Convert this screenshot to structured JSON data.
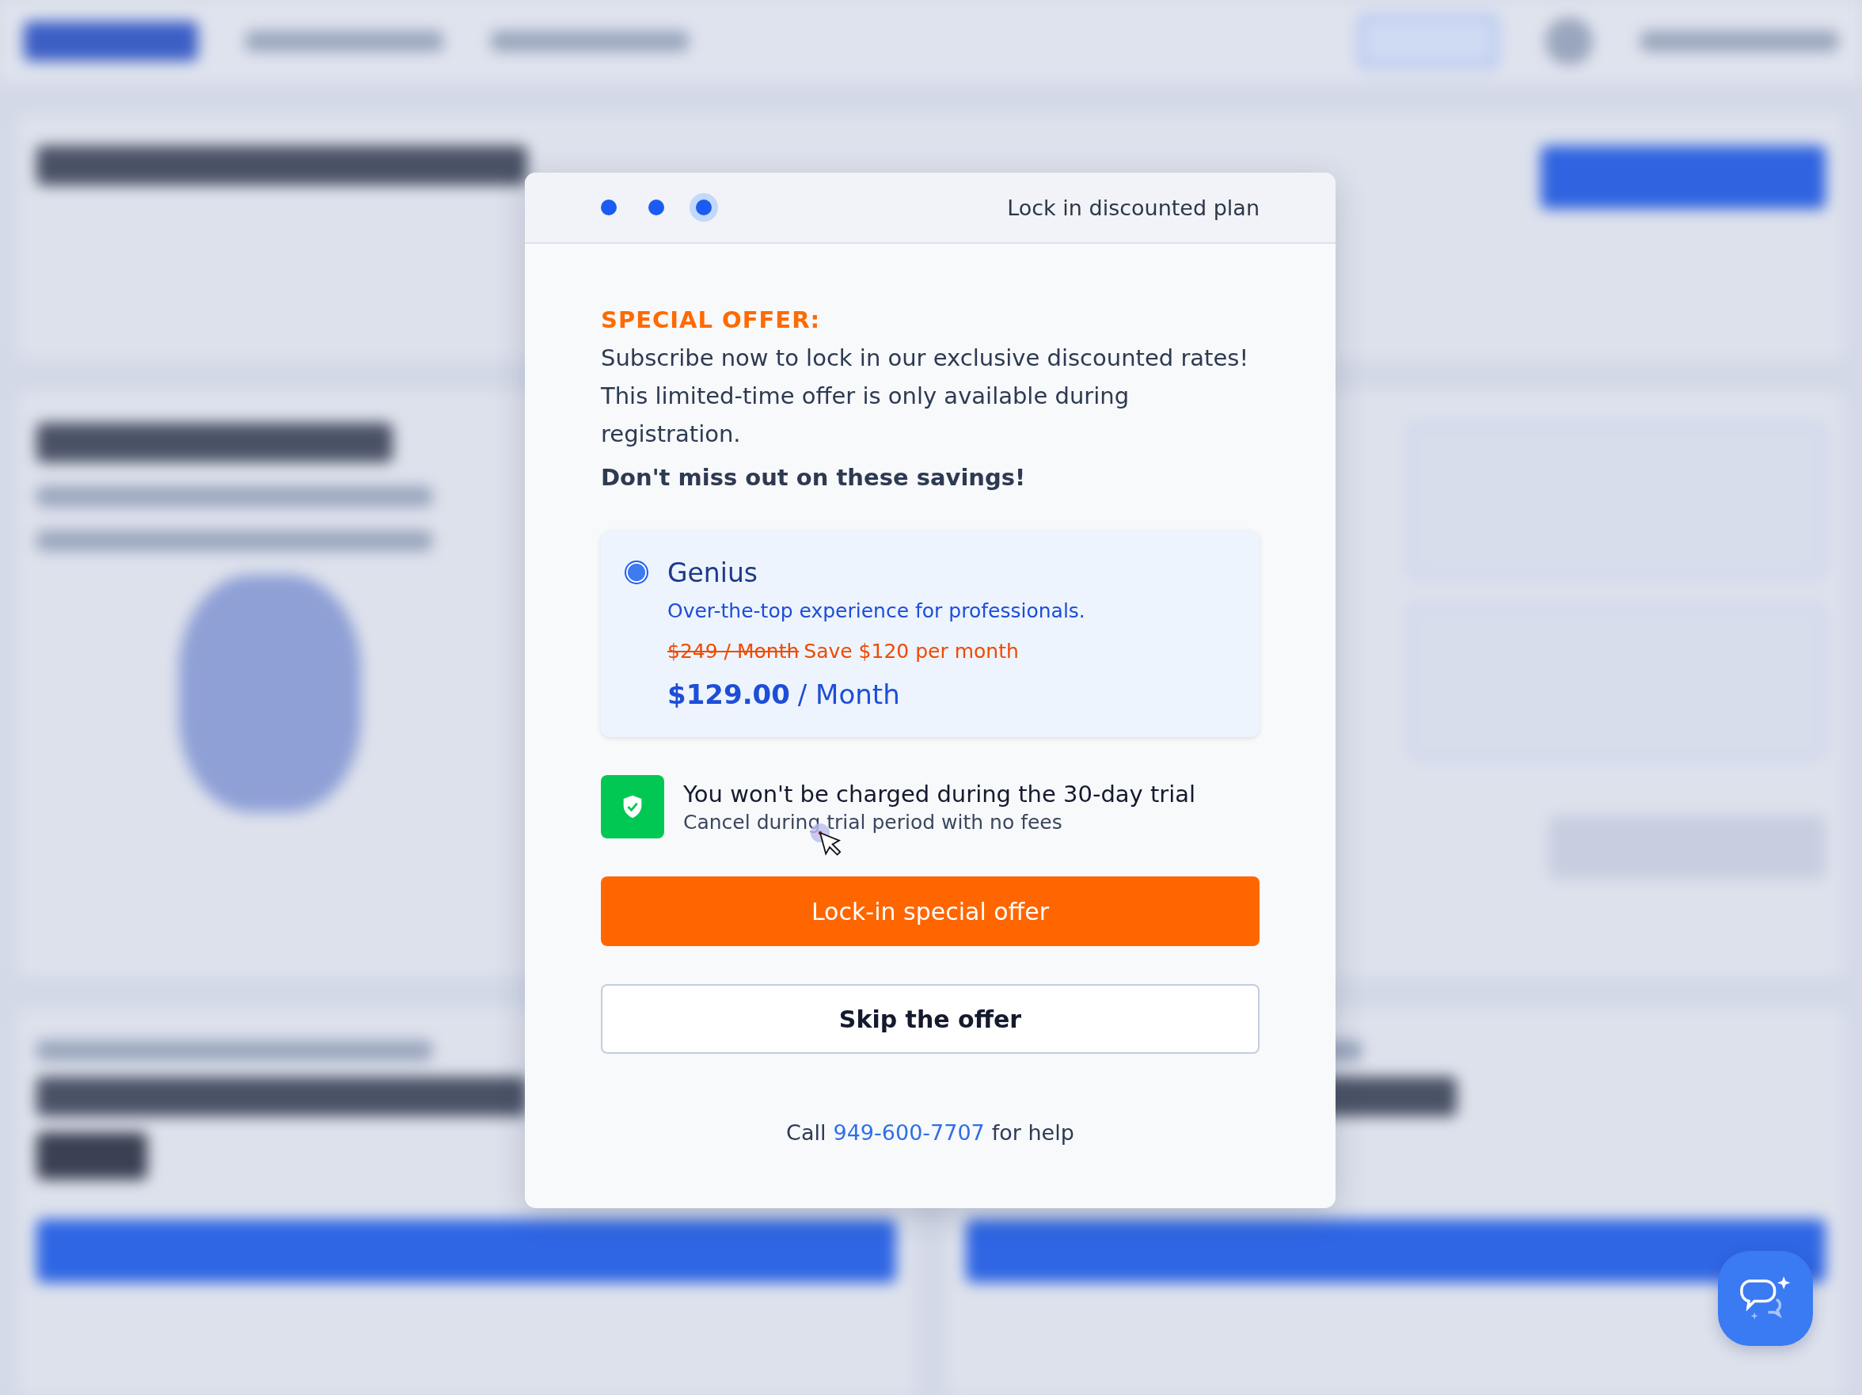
{
  "dialog": {
    "title": "Lock in discounted plan",
    "steps": [
      {
        "selected": false
      },
      {
        "selected": false
      },
      {
        "selected": true
      }
    ],
    "offer_label": "SPECIAL OFFER:",
    "offer_lines": [
      "Subscribe now to lock in our exclusive discounted rates!",
      "This limited-time offer is only available during registration."
    ],
    "emphasis": "Don't miss out on these savings!",
    "plan": {
      "name": "Genius",
      "selected": true,
      "description": "Over-the-top experience for professionals.",
      "old_price": "$249 / Month",
      "saving": "Save $120 per month",
      "price": "$129.00",
      "period": "/ Month"
    },
    "guarantee": {
      "title": "You won't be charged during the 30-day trial",
      "subtitle": "Cancel during trial period with no fees"
    },
    "primary_button": "Lock-in special offer",
    "secondary_button": "Skip the offer",
    "help": {
      "before": "Call",
      "phone": "949-600-7707",
      "after": "for help"
    }
  }
}
